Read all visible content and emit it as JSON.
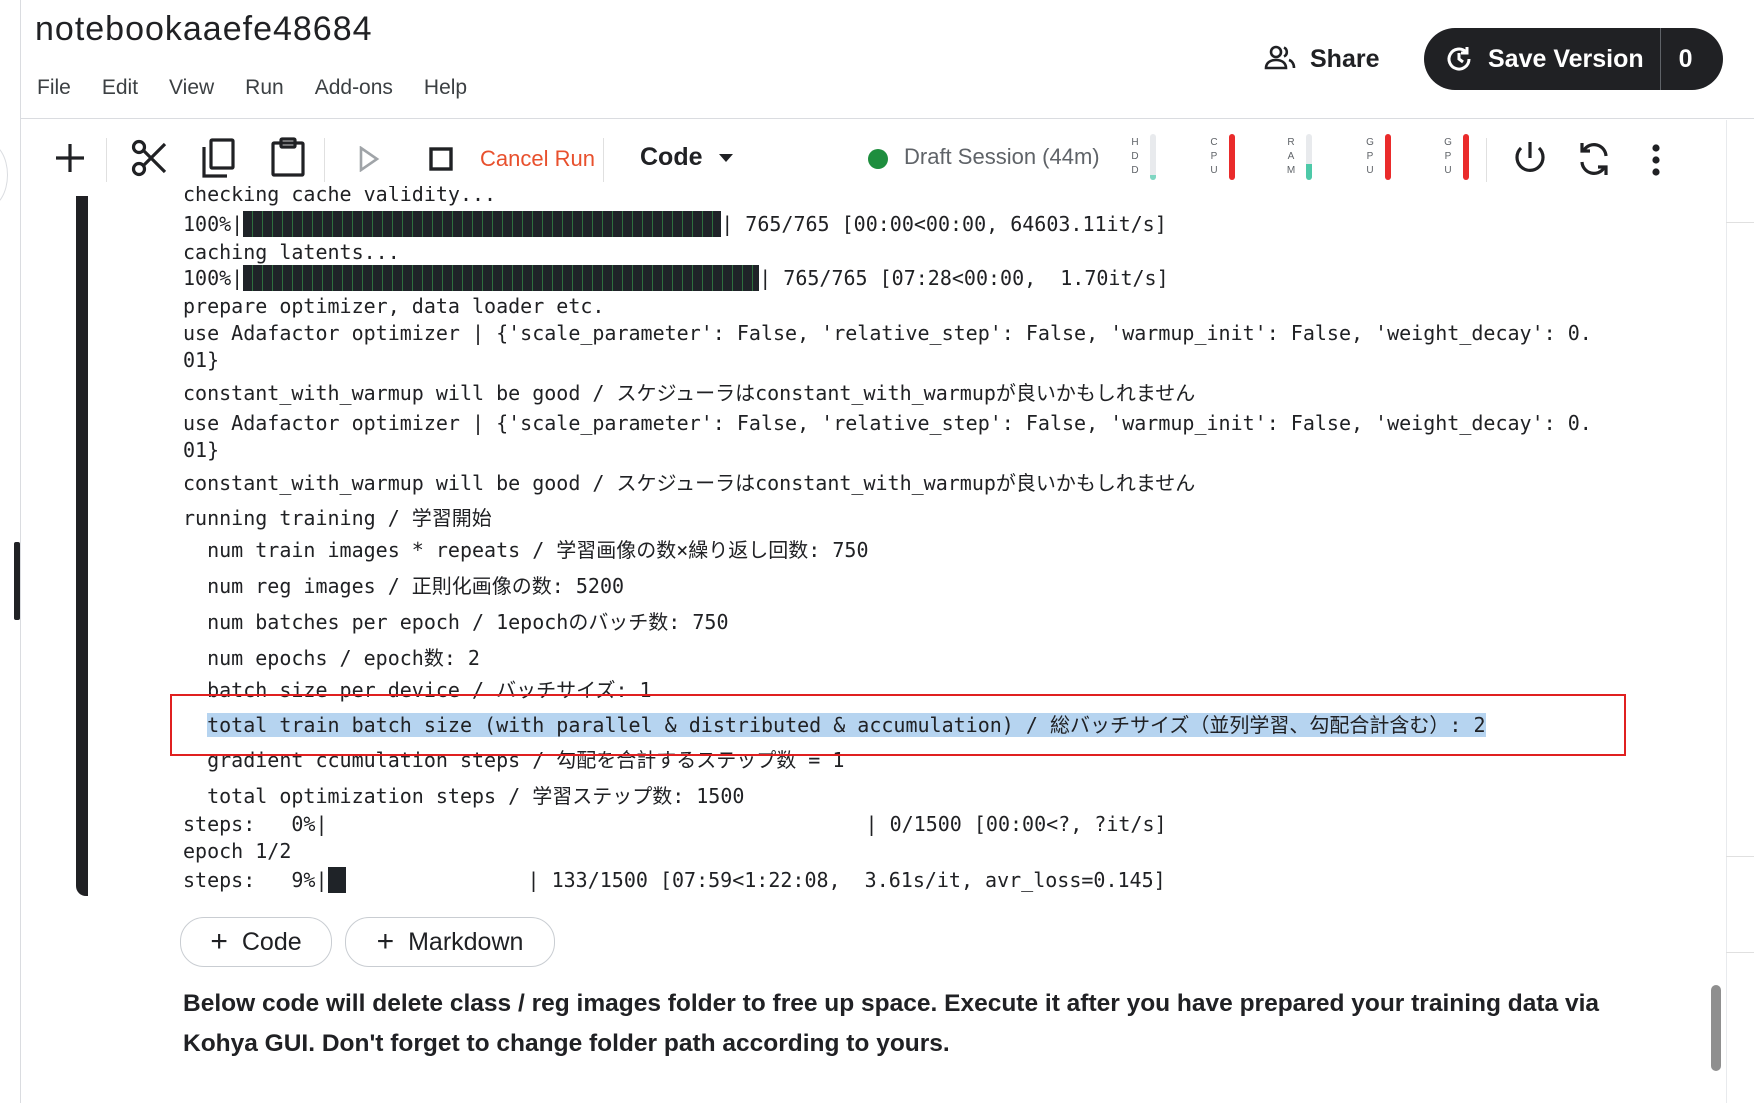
{
  "notebook": {
    "title": "notebookaaefe48684"
  },
  "menu": [
    "File",
    "Edit",
    "View",
    "Run",
    "Add-ons",
    "Help"
  ],
  "header": {
    "share_label": "Share",
    "save_version_label": "Save Version",
    "save_version_count": "0"
  },
  "toolbar": {
    "cancel_run_label": "Cancel Run",
    "cell_type": "Code",
    "session_label": "Draft Session (44m)",
    "session_status_color": "#1e8e3e",
    "icons": [
      "plus-icon",
      "scissors-icon",
      "copy-icon",
      "paste-icon",
      "play-icon",
      "stop-icon",
      "chevron-down-icon",
      "power-icon",
      "refresh-icon",
      "more-vertical-icon"
    ],
    "meters": [
      {
        "label": "HDD",
        "level": 0.1,
        "color": "#7fd6c2"
      },
      {
        "label": "CPU",
        "level": 1.0,
        "color": "#ea2b2b"
      },
      {
        "label": "RAM",
        "level": 0.35,
        "color": "#4dc9a8"
      },
      {
        "label": "GPU",
        "level": 1.0,
        "color": "#ea2b2b"
      },
      {
        "label": "GPU",
        "level": 1.0,
        "color": "#ea2b2b"
      }
    ]
  },
  "output": {
    "line_0": "checking cache validity...",
    "pbar1_prefix": "100%|",
    "pbar1_suffix": "| 765/765 [00:00<00:00, 64603.11it/s]",
    "line_caching": "caching latents...",
    "pbar2_prefix": "100%|",
    "pbar2_suffix": "| 765/765 [07:28<00:00,  1.70it/s]",
    "line_prepare": "prepare optimizer, data loader etc.",
    "line_adafactor_1a": "use Adafactor optimizer | {'scale_parameter': False, 'relative_step': False, 'warmup_init': False, 'weight_decay': 0.",
    "line_adafactor_1b": "01}",
    "line_warmup_1": "constant_with_warmup will be good / スケジューラはconstant_with_warmupが良いかもしれません",
    "line_adafactor_2a": "use Adafactor optimizer | {'scale_parameter': False, 'relative_step': False, 'warmup_init': False, 'weight_decay': 0.",
    "line_adafactor_2b": "01}",
    "line_warmup_2": "constant_with_warmup will be good / スケジューラはconstant_with_warmupが良いかもしれません",
    "line_running": "running training / 学習開始",
    "line_num_train": "  num train images * repeats / 学習画像の数×繰り返し回数: 750",
    "line_num_reg": "  num reg images / 正則化画像の数: 5200",
    "line_num_batches": "  num batches per epoch / 1epochのバッチ数: 750",
    "line_num_epochs": "  num epochs / epoch数: 2",
    "line_batch_size": "  batch size per device / バッチサイズ: 1",
    "line_total_batch_indent": "  ",
    "line_total_batch": "total train batch size (with parallel & distributed & accumulation) / 総バッチサイズ（並列学習、勾配合計含む）: 2",
    "line_grad_accum": "  gradient ccumulation steps / 勾配を合計するステップ数 = 1",
    "line_total_opt": "  total optimization steps / 学習ステップ数: 1500",
    "steps0_prefix": "steps:   0%|",
    "steps0_suffix": "| 0/1500 [00:00<?, ?it/s]",
    "line_epoch": "epoch 1/2",
    "steps9_prefix": "steps:   9%|",
    "steps9_suffix": "| 133/1500 [07:59<1:22:08,  3.61s/it, avr_loss=0.145]",
    "progress": {
      "cache_validity": 1.0,
      "caching_latents": 1.0,
      "steps_epoch_start": 0.0,
      "steps_current": 0.09
    }
  },
  "add_cell": {
    "code_label": "Code",
    "markdown_label": "Markdown"
  },
  "markdown_cell": {
    "text": "Below code will delete class / reg images folder to free up space. Execute it after you have prepared your training data via Kohya GUI. Don't forget to change folder path according to yours."
  }
}
